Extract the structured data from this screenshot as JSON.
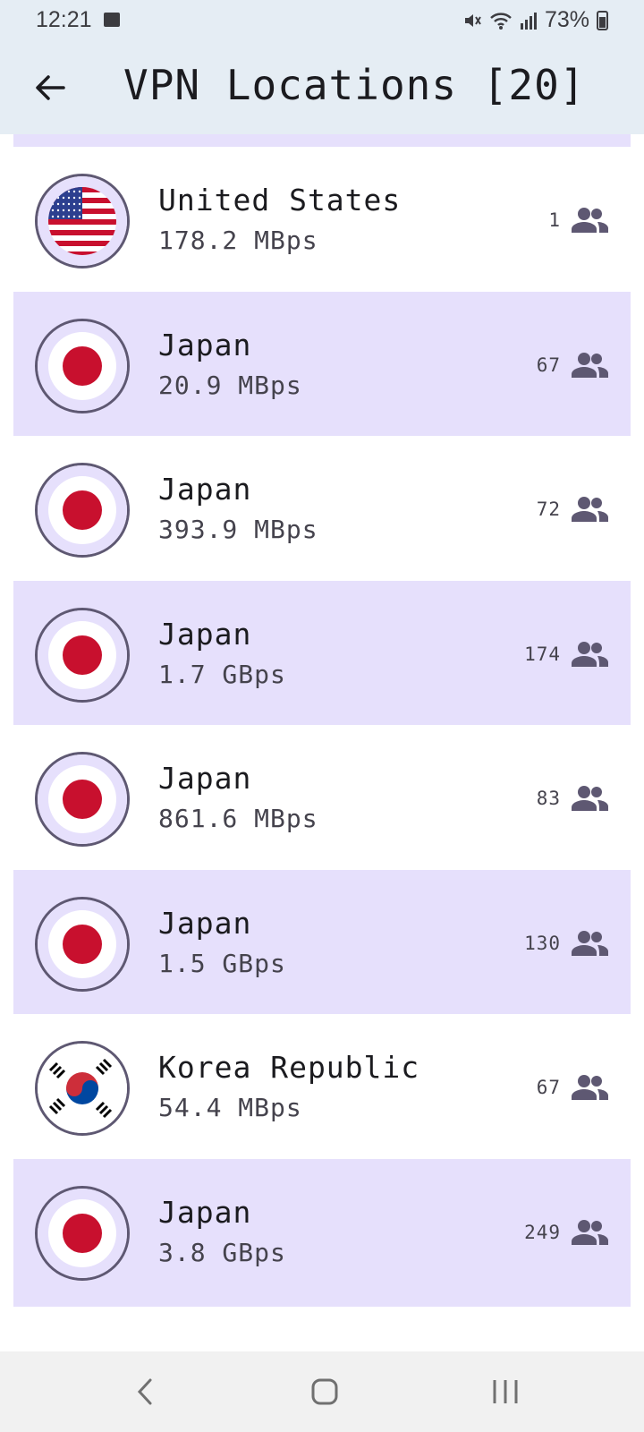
{
  "status_bar": {
    "time": "12:21",
    "battery": "73%"
  },
  "app_bar": {
    "title": "VPN Locations [20]"
  },
  "locations": [
    {
      "country": "United States",
      "speed": "178.2 MBps",
      "users": "1",
      "flag": "us-flag-icon"
    },
    {
      "country": "Japan",
      "speed": "20.9 MBps",
      "users": "67",
      "flag": "jp-flag-icon"
    },
    {
      "country": "Japan",
      "speed": "393.9 MBps",
      "users": "72",
      "flag": "jp-flag-icon"
    },
    {
      "country": "Japan",
      "speed": "1.7 GBps",
      "users": "174",
      "flag": "jp-flag-icon"
    },
    {
      "country": "Japan",
      "speed": "861.6 MBps",
      "users": "83",
      "flag": "jp-flag-icon"
    },
    {
      "country": "Japan",
      "speed": "1.5 GBps",
      "users": "130",
      "flag": "jp-flag-icon"
    },
    {
      "country": "Korea Republic",
      "speed": "54.4 MBps",
      "users": "67",
      "flag": "kr-flag-icon"
    },
    {
      "country": "Japan",
      "speed": "3.8 GBps",
      "users": "249",
      "flag": "jp-flag-icon"
    }
  ],
  "colors": {
    "app_bar_bg": "#e5edf4",
    "row_alt_bg": "#e6e0fc",
    "accent": "#5e5872"
  }
}
